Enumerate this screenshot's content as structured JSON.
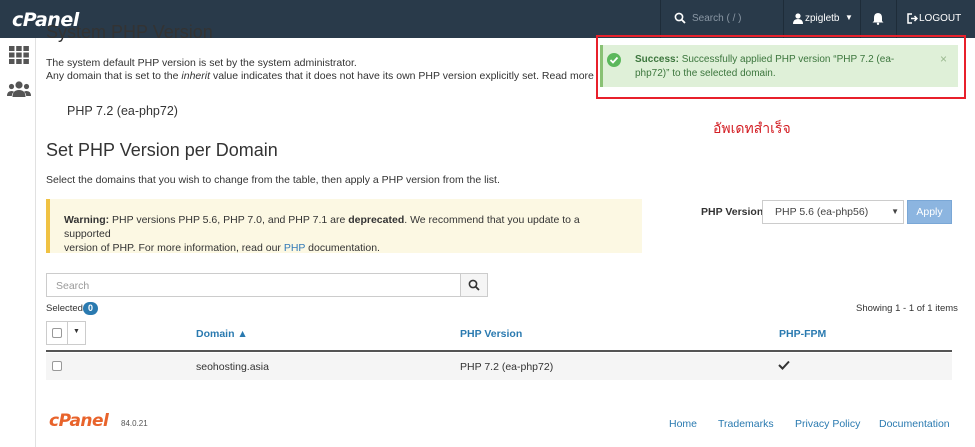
{
  "header": {
    "logo": "cPanel",
    "search_placeholder": "Search ( / )",
    "username": "zpigletb",
    "logout_label": "LOGOUT"
  },
  "system_php": {
    "title": "System PHP Version",
    "line1": "The system default PHP version is set by the system administrator.",
    "line2_prefix": "Any domain that is set to the ",
    "line2_emphasis": "inherit",
    "line2_suffix": " value indicates that it does not have its own PHP version explicitly set. Read more",
    "current_version": "PHP 7.2 (ea-php72)"
  },
  "per_domain": {
    "title": "Set PHP Version per Domain",
    "description": "Select the domains that you wish to change from the table, then apply a PHP version from the list.",
    "warning_label": "Warning:",
    "warning_text_1": " PHP versions PHP 5.6, PHP 7.0, and PHP 7.1 are ",
    "warning_bold": "deprecated",
    "warning_text_2": ". We recommend that you update to a supported",
    "warning_text_3": "version of PHP. For more information, read our ",
    "warning_link": "PHP",
    "warning_text_4": " documentation.",
    "php_version_label": "PHP Version",
    "php_version_selected": "PHP 5.6 (ea-php56)",
    "apply_label": "Apply",
    "search_placeholder": "Search",
    "selected_label": "Selected",
    "selected_count": "0",
    "showing_prefix": "Showing ",
    "showing_range": "1 - 1",
    "showing_suffix": " of 1 items"
  },
  "table": {
    "headers": [
      "Domain ▲",
      "PHP Version",
      "PHP-FPM"
    ],
    "rows": [
      {
        "domain": "seohosting.asia",
        "php_version": "PHP 7.2 (ea-php72)",
        "php_fpm": true
      }
    ]
  },
  "notification": {
    "label": "Success:",
    "message": " Successfully applied PHP version “PHP 7.2 (ea-php72)” to the selected domain.",
    "close": "×"
  },
  "annotation": {
    "thai_text": "อัพเดทสำเร็จ",
    "outline_color": "#e8202b"
  },
  "footer": {
    "logo": "cPanel",
    "version": "84.0.21",
    "links": [
      "Home",
      "Trademarks",
      "Privacy Policy",
      "Documentation"
    ]
  },
  "colors": {
    "topbar": "#293a4a",
    "link": "#2a7ab0",
    "success_bg": "#dff0d8",
    "warning_bg": "#fcf8e3",
    "footer_logo": "#e8632b"
  }
}
